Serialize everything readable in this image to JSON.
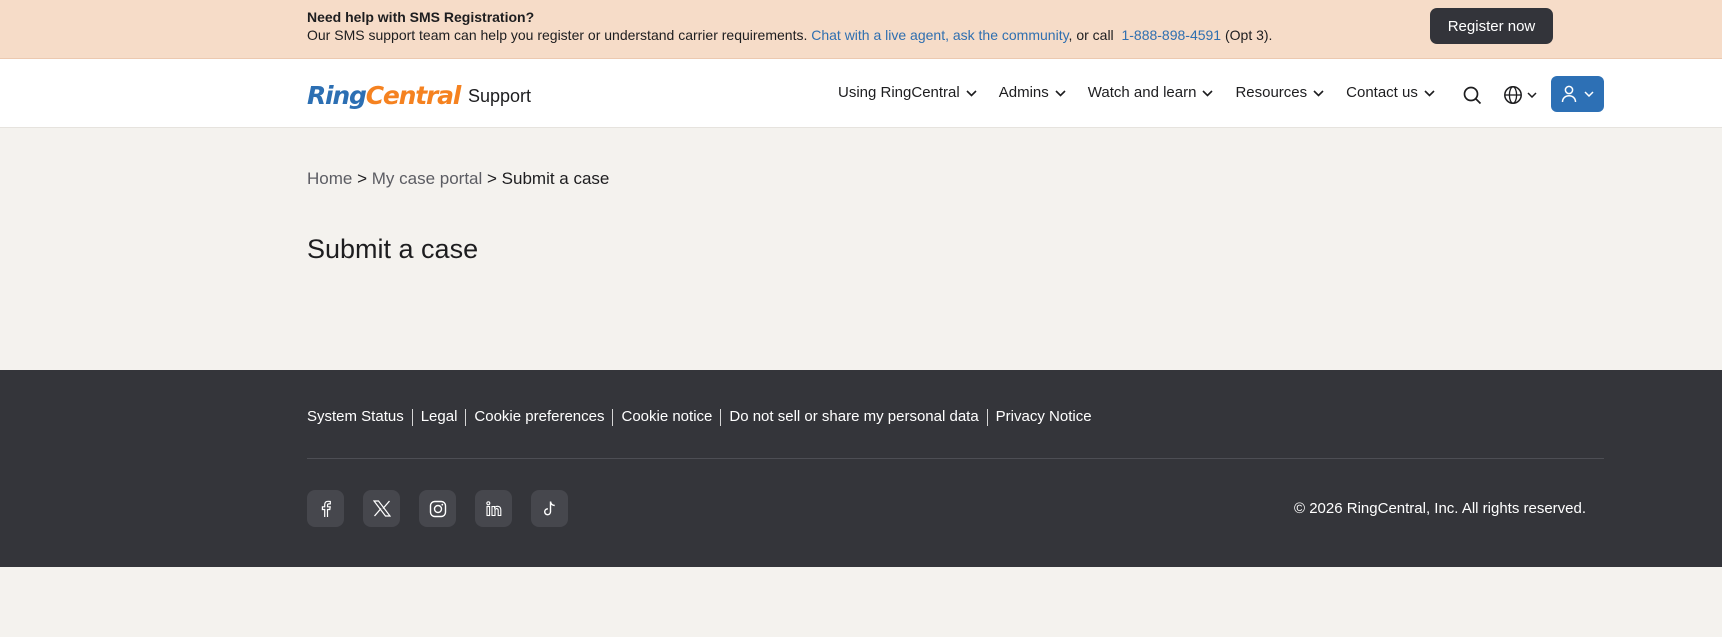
{
  "banner": {
    "title": "Need help with SMS Registration?",
    "text_before": "Our SMS support team can help you register or understand carrier requirements. ",
    "link_text": "Chat with a live agent, ask the community",
    "text_middle": ", or call ",
    "phone": "1-888-898-4591",
    "text_after": " (Opt 3).",
    "button_label": "Register now"
  },
  "header": {
    "logo_part1": "Ring",
    "logo_part2": "Central",
    "support_label": "Support",
    "nav": [
      {
        "label": "Using RingCentral"
      },
      {
        "label": "Admins"
      },
      {
        "label": "Watch and learn"
      },
      {
        "label": "Resources"
      },
      {
        "label": "Contact us"
      }
    ],
    "icons": {
      "search": "search-icon",
      "language": "globe-icon",
      "account": "user-icon"
    }
  },
  "breadcrumb": {
    "home": "Home",
    "sep1": " > ",
    "portal": "My case portal",
    "sep2": " > ",
    "current": "Submit a case"
  },
  "page": {
    "title": "Submit a case"
  },
  "footer": {
    "links": [
      "System Status",
      "Legal",
      "Cookie preferences",
      "Cookie notice",
      "Do not sell or share my personal data",
      "Privacy Notice"
    ],
    "socials": [
      "facebook-icon",
      "x-icon",
      "instagram-icon",
      "linkedin-icon",
      "tiktok-icon"
    ],
    "copyright": "© 2026 RingCentral, Inc. All rights reserved."
  },
  "colors": {
    "banner_bg": "#f6dcc8",
    "link_blue": "#2f6fb0",
    "brand_blue": "#2c6fb3",
    "brand_orange": "#f58220",
    "footer_bg": "#34353a",
    "page_bg": "#f4f2ee"
  }
}
